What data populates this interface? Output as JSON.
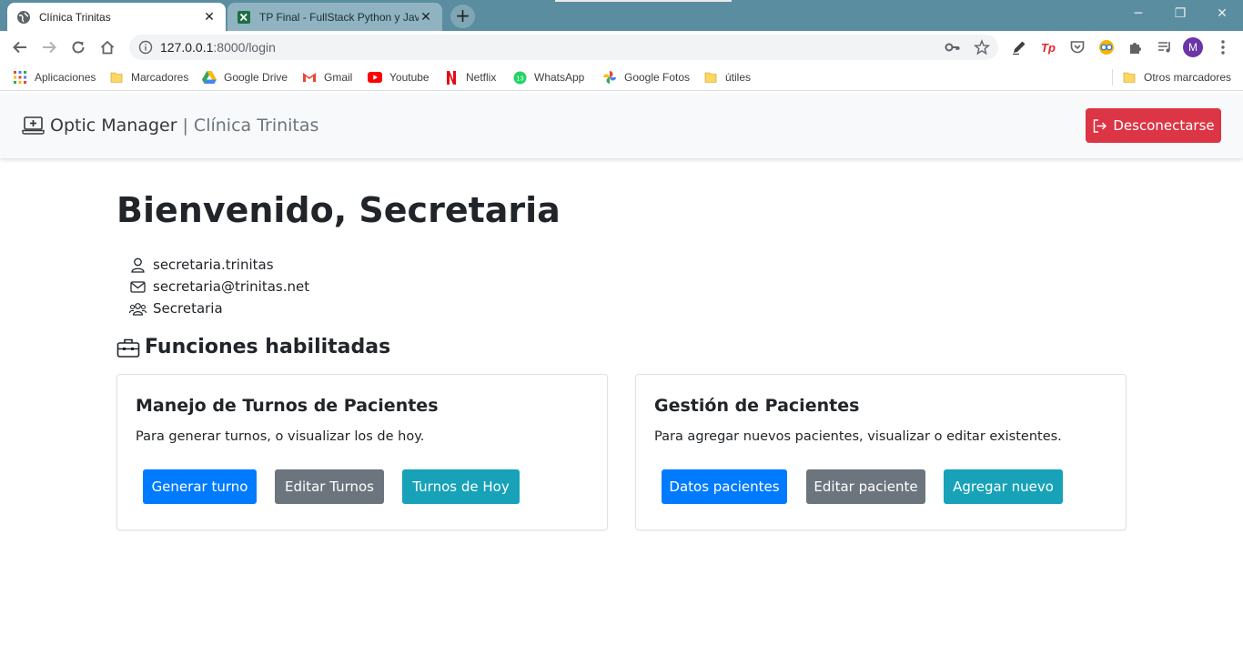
{
  "browser": {
    "tabs": [
      {
        "title": "Clínica Trinitas",
        "active": true,
        "icon": "globe-icon"
      },
      {
        "title": "TP Final - FullStack Python y Java",
        "active": false,
        "icon": "excel-icon"
      }
    ],
    "new_tab": "+",
    "window_controls": {
      "minimize": "─",
      "restore": "❐",
      "close": "✕"
    },
    "url_host": "127.0.0.1",
    "url_path": ":8000/login",
    "profile_initial": "M",
    "bookmarks": [
      {
        "label": "Aplicaciones",
        "icon": "apps-grid-icon"
      },
      {
        "label": "Marcadores",
        "icon": "folder-icon"
      },
      {
        "label": "Google Drive",
        "icon": "google-drive-icon"
      },
      {
        "label": "Gmail",
        "icon": "gmail-icon"
      },
      {
        "label": "Youtube",
        "icon": "youtube-icon"
      },
      {
        "label": "Netflix",
        "icon": "netflix-icon"
      },
      {
        "label": "WhatsApp",
        "icon": "whatsapp-icon"
      },
      {
        "label": "Google Fotos",
        "icon": "google-photos-icon"
      },
      {
        "label": "útiles",
        "icon": "folder-icon"
      }
    ],
    "other_bookmarks": "Otros marcadores",
    "colors": {
      "tabstrip": "#5b8da0",
      "profile": "#6935a8"
    }
  },
  "app": {
    "brand_name": "Optic Manager",
    "brand_separator": "|",
    "brand_clinic": "Clínica Trinitas",
    "logout_label": "Desconectarse",
    "welcome": "Bienvenido, Secretaria",
    "user": {
      "username": "secretaria.trinitas",
      "email": "secretaria@trinitas.net",
      "role": "Secretaria"
    },
    "functions_title": "Funciones habilitadas",
    "cards": [
      {
        "title": "Manejo de Turnos de Pacientes",
        "text": "Para generar turnos, o visualizar los de hoy.",
        "buttons": [
          "Generar turno",
          "Editar Turnos",
          "Turnos de Hoy"
        ]
      },
      {
        "title": "Gestión de Pacientes",
        "text": "Para agregar nuevos pacientes, visualizar o editar existentes.",
        "buttons": [
          "Datos pacientes",
          "Editar paciente",
          "Agregar nuevo"
        ]
      }
    ],
    "colors": {
      "primary": "#007bff",
      "secondary": "#6c757d",
      "info": "#17a2b8",
      "danger": "#dc3545"
    }
  }
}
